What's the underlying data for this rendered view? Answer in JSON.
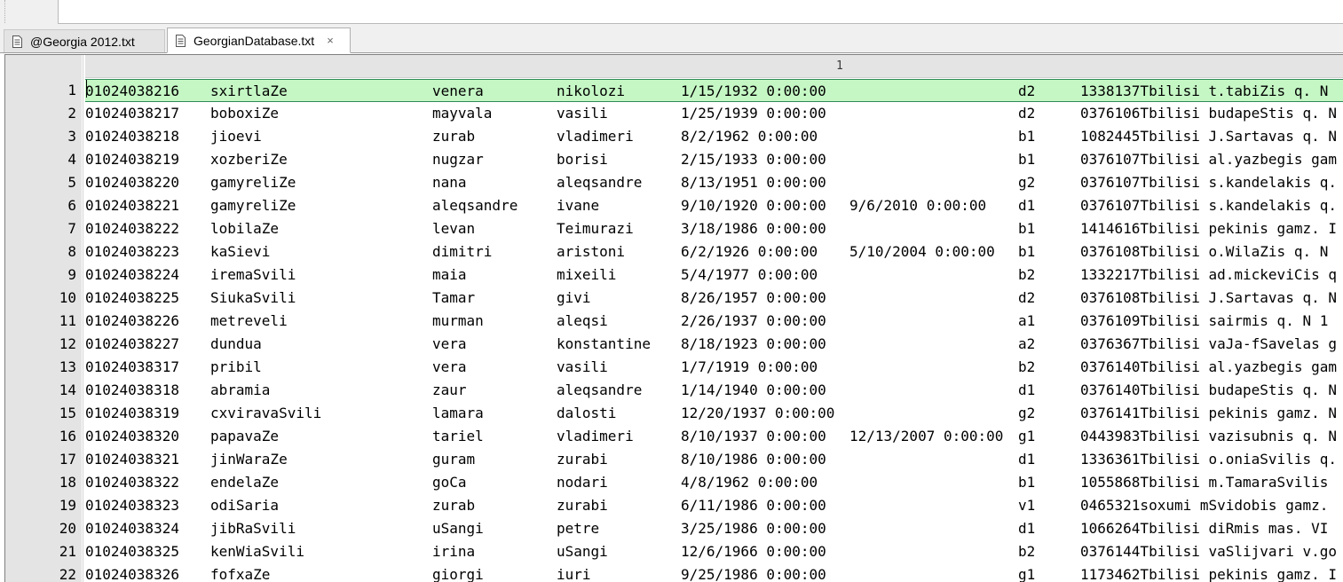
{
  "tabs": [
    {
      "label": "@Georgia 2012.txt",
      "active": false
    },
    {
      "label": "GeorgianDatabase.txt",
      "active": true,
      "close": "×"
    }
  ],
  "ruler": {
    "column": "1"
  },
  "rows": [
    {
      "n": "1",
      "id": "01024038216",
      "surname": "sxirtlaZe",
      "first": "venera",
      "father": "nikolozi",
      "birth": "1/15/1932 0:00:00",
      "death": "",
      "code": "d2",
      "addr": "1338137Tbilisi t.tabiZis q. N"
    },
    {
      "n": "2",
      "id": "01024038217",
      "surname": "boboxiZe",
      "first": "mayvala",
      "father": "vasili",
      "birth": "1/25/1939 0:00:00",
      "death": "",
      "code": "d2",
      "addr": "0376106Tbilisi budapeStis q. N"
    },
    {
      "n": "3",
      "id": "01024038218",
      "surname": "jioevi",
      "first": "zurab",
      "father": "vladimeri",
      "birth": "8/2/1962 0:00:00",
      "death": "",
      "code": "b1",
      "addr": "1082445Tbilisi J.Sartavas q. N"
    },
    {
      "n": "4",
      "id": "01024038219",
      "surname": "xozberiZe",
      "first": "nugzar",
      "father": "borisi",
      "birth": "2/15/1933 0:00:00",
      "death": "",
      "code": "b1",
      "addr": "0376107Tbilisi al.yazbegis gam"
    },
    {
      "n": "5",
      "id": "01024038220",
      "surname": "gamyreliZe",
      "first": "nana",
      "father": "aleqsandre",
      "birth": "8/13/1951 0:00:00",
      "death": "",
      "code": "g2",
      "addr": "0376107Tbilisi s.kandelakis q."
    },
    {
      "n": "6",
      "id": "01024038221",
      "surname": "gamyreliZe",
      "first": "aleqsandre",
      "father": "ivane",
      "birth": "9/10/1920 0:00:00",
      "death": "9/6/2010 0:00:00",
      "code": "d1",
      "addr": "0376107Tbilisi s.kandelakis q."
    },
    {
      "n": "7",
      "id": "01024038222",
      "surname": "lobilaZe",
      "first": "levan",
      "father": "Teimurazi",
      "birth": "3/18/1986 0:00:00",
      "death": "",
      "code": "b1",
      "addr": "1414616Tbilisi pekinis gamz. I"
    },
    {
      "n": "8",
      "id": "01024038223",
      "surname": "kaSievi",
      "first": "dimitri",
      "father": "aristoni",
      "birth": "6/2/1926 0:00:00",
      "death": "5/10/2004 0:00:00",
      "code": "b1",
      "addr": "0376108Tbilisi o.WilaZis q. N"
    },
    {
      "n": "9",
      "id": "01024038224",
      "surname": "iremaSvili",
      "first": "maia",
      "father": "mixeili",
      "birth": "5/4/1977 0:00:00",
      "death": "",
      "code": "b2",
      "addr": "1332217Tbilisi ad.mickeviCis q"
    },
    {
      "n": "10",
      "id": "01024038225",
      "surname": "SiukaSvili",
      "first": "Tamar",
      "father": "givi",
      "birth": "8/26/1957 0:00:00",
      "death": "",
      "code": "d2",
      "addr": "0376108Tbilisi J.Sartavas q. N"
    },
    {
      "n": "11",
      "id": "01024038226",
      "surname": "metreveli",
      "first": "murman",
      "father": "aleqsi",
      "birth": "2/26/1937 0:00:00",
      "death": "",
      "code": "a1",
      "addr": "0376109Tbilisi sairmis q. N 1"
    },
    {
      "n": "12",
      "id": "01024038227",
      "surname": "dundua",
      "first": "vera",
      "father": "konstantine",
      "birth": "8/18/1923 0:00:00",
      "death": "",
      "code": "a2",
      "addr": "0376367Tbilisi vaJa-fSavelas g"
    },
    {
      "n": "13",
      "id": "01024038317",
      "surname": "pribil",
      "first": "vera",
      "father": "vasili",
      "birth": "1/7/1919 0:00:00",
      "death": "",
      "code": "b2",
      "addr": "0376140Tbilisi al.yazbegis gam"
    },
    {
      "n": "14",
      "id": "01024038318",
      "surname": "abramia",
      "first": "zaur",
      "father": "aleqsandre",
      "birth": "1/14/1940 0:00:00",
      "death": "",
      "code": "d1",
      "addr": "0376140Tbilisi budapeStis q. N"
    },
    {
      "n": "15",
      "id": "01024038319",
      "surname": "cxviravaSvili",
      "first": "lamara",
      "father": "dalosti",
      "birth": "12/20/1937 0:00:00",
      "death": "",
      "code": "g2",
      "addr": "0376141Tbilisi pekinis gamz. N"
    },
    {
      "n": "16",
      "id": "01024038320",
      "surname": "papavaZe",
      "first": "tariel",
      "father": "vladimeri",
      "birth": "8/10/1937 0:00:00",
      "death": "12/13/2007 0:00:00",
      "code": "g1",
      "addr": "0443983Tbilisi vazisubnis q. N"
    },
    {
      "n": "17",
      "id": "01024038321",
      "surname": "jinWaraZe",
      "first": "guram",
      "father": "zurabi",
      "birth": "8/10/1986 0:00:00",
      "death": "",
      "code": "d1",
      "addr": "1336361Tbilisi o.oniaSvilis q."
    },
    {
      "n": "18",
      "id": "01024038322",
      "surname": "endelaZe",
      "first": "goCa",
      "father": "nodari",
      "birth": "4/8/1962 0:00:00",
      "death": "",
      "code": "b1",
      "addr": "1055868Tbilisi m.TamaraSvilis"
    },
    {
      "n": "19",
      "id": "01024038323",
      "surname": "odiSaria",
      "first": "zurab",
      "father": "zurabi",
      "birth": "6/11/1986 0:00:00",
      "death": "",
      "code": "v1",
      "addr": "0465321soxumi mSvidobis gamz."
    },
    {
      "n": "20",
      "id": "01024038324",
      "surname": "jibRaSvili",
      "first": "uSangi",
      "father": "petre",
      "birth": "3/25/1986 0:00:00",
      "death": "",
      "code": "d1",
      "addr": "1066264Tbilisi diRmis mas. VI"
    },
    {
      "n": "21",
      "id": "01024038325",
      "surname": "kenWiaSvili",
      "first": "irina",
      "father": "uSangi",
      "birth": "12/6/1966 0:00:00",
      "death": "",
      "code": "b2",
      "addr": "0376144Tbilisi vaSlijvari v.go"
    },
    {
      "n": "22",
      "id": "01024038326",
      "surname": "fofxaZe",
      "first": "giorgi",
      "father": "iuri",
      "birth": "9/25/1986 0:00:00",
      "death": "",
      "code": "g1",
      "addr": "1173462Tbilisi pekinis gamz. I"
    }
  ]
}
